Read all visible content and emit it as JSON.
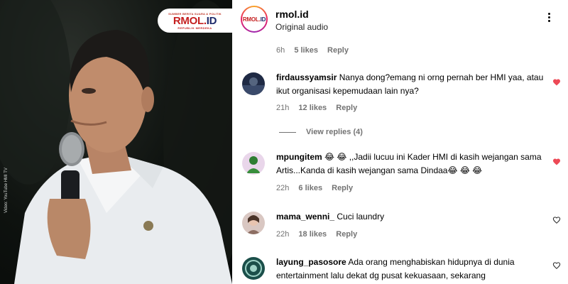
{
  "video": {
    "logo_top": "SUMBER BERITA SUARA & POLITIK",
    "logo_main_a": "RMOL.",
    "logo_main_b": "ID",
    "logo_bottom": "REPUBLIK MERDEKA",
    "credit": "Video: YouTube HMI TV"
  },
  "header": {
    "channel_name": "rmol.id",
    "audio_label": "Original audio",
    "avatar_text_a": "RMOL.",
    "avatar_text_b": "ID",
    "more_icon": "more-vertical-icon"
  },
  "top_meta": {
    "time": "6h",
    "likes": "5 likes",
    "reply": "Reply"
  },
  "comments": [
    {
      "username": "firdaussyamsir",
      "text": " Nanya dong?emang ni orng pernah ber HMI yaa, atau ikut organisasi kepemudaan lain nya?",
      "time": "21h",
      "likes": "12 likes",
      "reply": "Reply",
      "liked": true
    },
    {
      "username": "mpungitem",
      "text": " 😂 😂 ,,Jadii lucuu ini Kader HMI di kasih wejangan sama Artis...Kanda di kasih wejangan sama Dindaa😂 😂 😂",
      "time": "22h",
      "likes": "6 likes",
      "reply": "Reply",
      "liked": true
    },
    {
      "username": "mama_wenni_",
      "text": " Cuci laundry",
      "time": "22h",
      "likes": "18 likes",
      "reply": "Reply",
      "liked": false
    },
    {
      "username": "layung_pasosore",
      "text": " Ada orang menghabiskan hidupnya di dunia entertainment lalu dekat dg pusat kekuasaan, sekarang",
      "liked": false
    }
  ],
  "view_replies": "View replies (4)",
  "colors": {
    "heart_red": "#ed4956",
    "meta_gray": "#737373",
    "brand_red": "#c41e1e",
    "brand_navy": "#1d2a6b"
  }
}
